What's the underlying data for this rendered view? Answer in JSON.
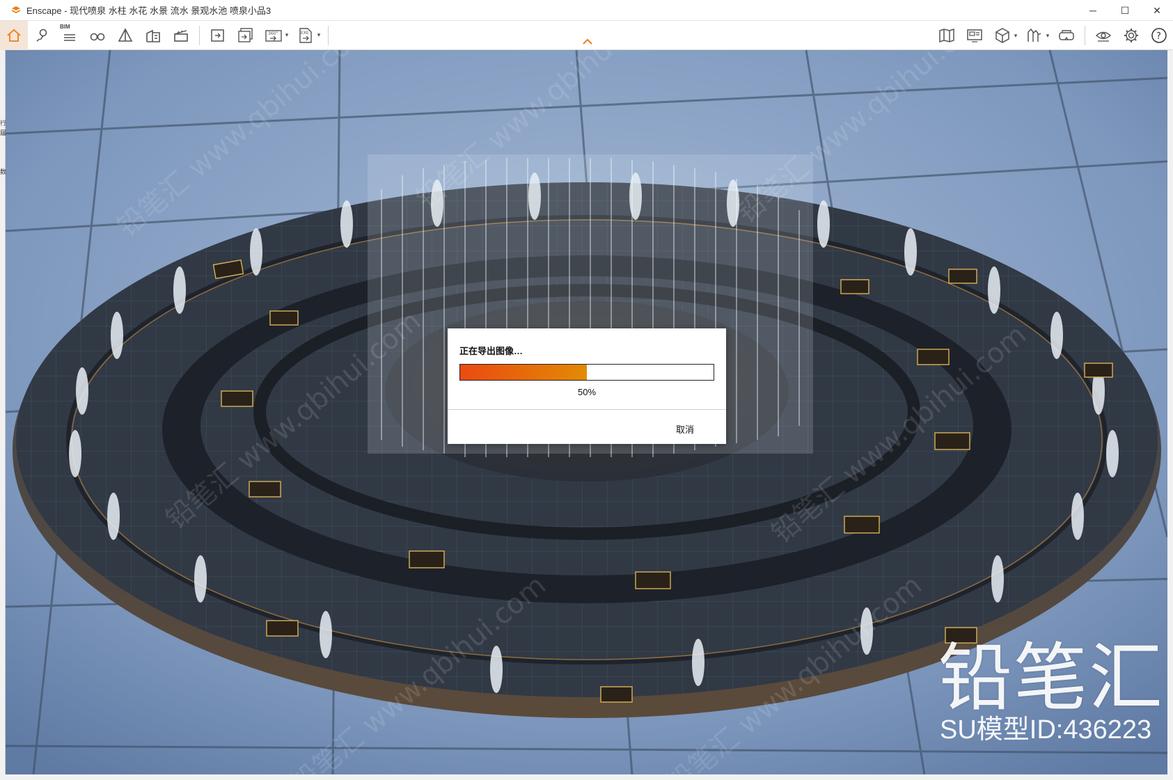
{
  "window": {
    "app_name": "Enscape",
    "title": "Enscape - 现代喷泉 水柱 水花 水景 流水 景观水池 喷泉小品3",
    "controls": {
      "minimize": "─",
      "maximize": "☐",
      "close": "✕"
    }
  },
  "toolbar": {
    "left_tools": [
      {
        "name": "home",
        "active": true
      },
      {
        "name": "location-pin"
      },
      {
        "name": "bim",
        "label": "BIM"
      },
      {
        "name": "binoculars"
      },
      {
        "name": "perspective"
      },
      {
        "name": "building"
      },
      {
        "name": "clapperboard"
      }
    ],
    "export_tools": [
      {
        "name": "screenshot-export"
      },
      {
        "name": "batch-export"
      },
      {
        "name": "panorama-360",
        "label": "360°",
        "has_dropdown": true
      },
      {
        "name": "exe-export",
        "label": "EXE",
        "has_dropdown": true
      }
    ],
    "right_tools": [
      {
        "name": "map"
      },
      {
        "name": "monitor-view"
      },
      {
        "name": "material-box",
        "has_dropdown": true
      },
      {
        "name": "asset-library",
        "has_dropdown": true
      },
      {
        "name": "vr-headset"
      },
      {
        "name": "visibility"
      },
      {
        "name": "settings"
      },
      {
        "name": "help"
      }
    ],
    "collapse_caret": "^"
  },
  "left_strip": {
    "glyphs": "行\n届\n\n\n\n数"
  },
  "dialog": {
    "title": "正在导出图像…",
    "progress": 0.5,
    "progress_label": "50%",
    "cancel_label": "取消",
    "fill_color_start": "#ea4a12",
    "fill_color_end": "#e38a05"
  },
  "watermark": {
    "brand": "铅笔汇",
    "model_id": "SU模型ID:436223",
    "tile_text": "铅笔汇 www.qbihui.com"
  },
  "colors": {
    "accent": "#f07d1a",
    "sky": "#7d97bd",
    "plaza": "#2c3440"
  }
}
